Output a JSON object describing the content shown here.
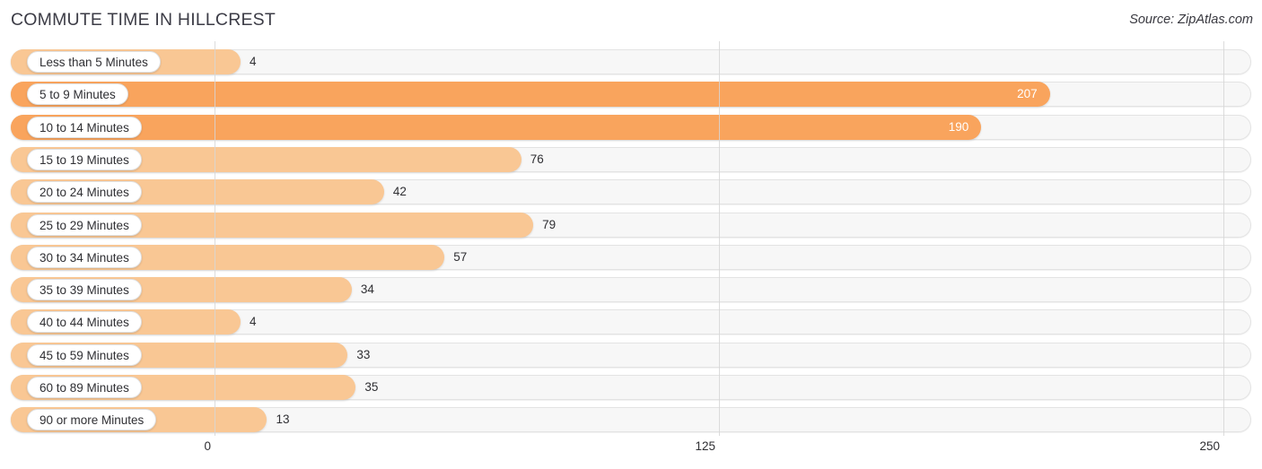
{
  "header": {
    "title": "COMMUTE TIME IN HILLCREST",
    "source": "Source: ZipAtlas.com"
  },
  "chart_data": {
    "type": "bar",
    "orientation": "horizontal",
    "title": "COMMUTE TIME IN HILLCREST",
    "subtitle": "Source: ZipAtlas.com",
    "xlabel": "",
    "ylabel": "",
    "xlim": [
      0,
      250
    ],
    "grid": true,
    "legend": false,
    "axis_ticks": [
      "0",
      "125",
      "250"
    ],
    "axis_tick_values": [
      0,
      125,
      250
    ],
    "categories": [
      "Less than 5 Minutes",
      "5 to 9 Minutes",
      "10 to 14 Minutes",
      "15 to 19 Minutes",
      "20 to 24 Minutes",
      "25 to 29 Minutes",
      "30 to 34 Minutes",
      "35 to 39 Minutes",
      "40 to 44 Minutes",
      "45 to 59 Minutes",
      "60 to 89 Minutes",
      "90 or more Minutes"
    ],
    "values": [
      4,
      207,
      190,
      76,
      42,
      79,
      57,
      34,
      4,
      33,
      35,
      13
    ],
    "value_labels": [
      "4",
      "207",
      "190",
      "76",
      "42",
      "79",
      "57",
      "34",
      "4",
      "33",
      "35",
      "13"
    ],
    "colors": {
      "bar_highlight": "#f9a45d",
      "bar_normal": "#f9c794",
      "track": "#f7f7f7",
      "gridline": "#d6d6d6",
      "label_text": "#2f2f33",
      "inside_label_text": "#ffffff"
    },
    "bars": [
      {
        "category": "Less than 5 Minutes",
        "value": 4,
        "label": "4",
        "color": "#f9c794",
        "label_inside": false
      },
      {
        "category": "5 to 9 Minutes",
        "value": 207,
        "label": "207",
        "color": "#f9a45d",
        "label_inside": true
      },
      {
        "category": "10 to 14 Minutes",
        "value": 190,
        "label": "190",
        "color": "#f9a45d",
        "label_inside": true
      },
      {
        "category": "15 to 19 Minutes",
        "value": 76,
        "label": "76",
        "color": "#f9c794",
        "label_inside": false
      },
      {
        "category": "20 to 24 Minutes",
        "value": 42,
        "label": "42",
        "color": "#f9c794",
        "label_inside": false
      },
      {
        "category": "25 to 29 Minutes",
        "value": 79,
        "label": "79",
        "color": "#f9c794",
        "label_inside": false
      },
      {
        "category": "30 to 34 Minutes",
        "value": 57,
        "label": "57",
        "color": "#f9c794",
        "label_inside": false
      },
      {
        "category": "35 to 39 Minutes",
        "value": 34,
        "label": "34",
        "color": "#f9c794",
        "label_inside": false
      },
      {
        "category": "40 to 44 Minutes",
        "value": 4,
        "label": "4",
        "color": "#f9c794",
        "label_inside": false
      },
      {
        "category": "45 to 59 Minutes",
        "value": 33,
        "label": "33",
        "color": "#f9c794",
        "label_inside": false
      },
      {
        "category": "60 to 89 Minutes",
        "value": 35,
        "label": "35",
        "color": "#f9c794",
        "label_inside": false
      },
      {
        "category": "90 or more Minutes",
        "value": 13,
        "label": "13",
        "color": "#f9c794",
        "label_inside": false
      }
    ]
  }
}
